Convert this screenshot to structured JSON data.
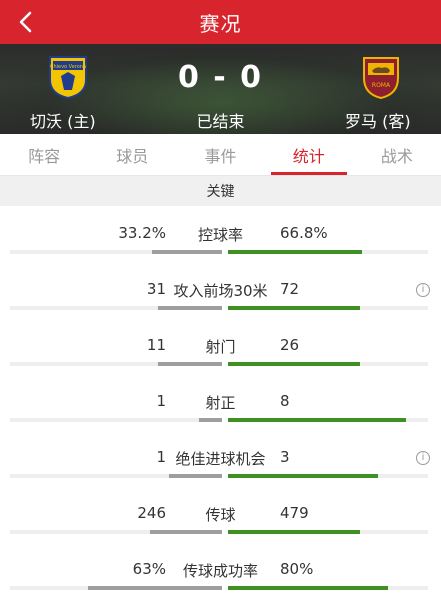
{
  "header": {
    "title": "赛况"
  },
  "match": {
    "home_team": "切沃 (主)",
    "away_team": "罗马 (客)",
    "score": "0 - 0",
    "status": "已结束",
    "home_crest_text": "Chievo Verona",
    "away_crest_text": "ROMA"
  },
  "tabs": [
    {
      "label": "阵容",
      "active": false
    },
    {
      "label": "球员",
      "active": false
    },
    {
      "label": "事件",
      "active": false
    },
    {
      "label": "统计",
      "active": true
    },
    {
      "label": "战术",
      "active": false
    }
  ],
  "section": {
    "title": "关键"
  },
  "stats": [
    {
      "label": "控球率",
      "home": "33.2%",
      "away": "66.8%",
      "home_share": 0.332,
      "away_share": 0.668,
      "info": false
    },
    {
      "label": "攻入前场30米",
      "home": "31",
      "away": "72",
      "home_share": 0.3,
      "away_share": 0.66,
      "info": true
    },
    {
      "label": "射门",
      "home": "11",
      "away": "26",
      "home_share": 0.3,
      "away_share": 0.66,
      "info": false
    },
    {
      "label": "射正",
      "home": "1",
      "away": "8",
      "home_share": 0.11,
      "away_share": 0.89,
      "info": false
    },
    {
      "label": "绝佳进球机会",
      "home": "1",
      "away": "3",
      "home_share": 0.25,
      "away_share": 0.75,
      "info": true
    },
    {
      "label": "传球",
      "home": "246",
      "away": "479",
      "home_share": 0.34,
      "away_share": 0.66,
      "info": false
    },
    {
      "label": "传球成功率",
      "home": "63%",
      "away": "80%",
      "home_share": 0.63,
      "away_share": 0.8,
      "info": false
    }
  ],
  "colors": {
    "accent": "#d8252d",
    "home_bar": "#9e9e9e",
    "away_bar": "#3f8f22"
  }
}
